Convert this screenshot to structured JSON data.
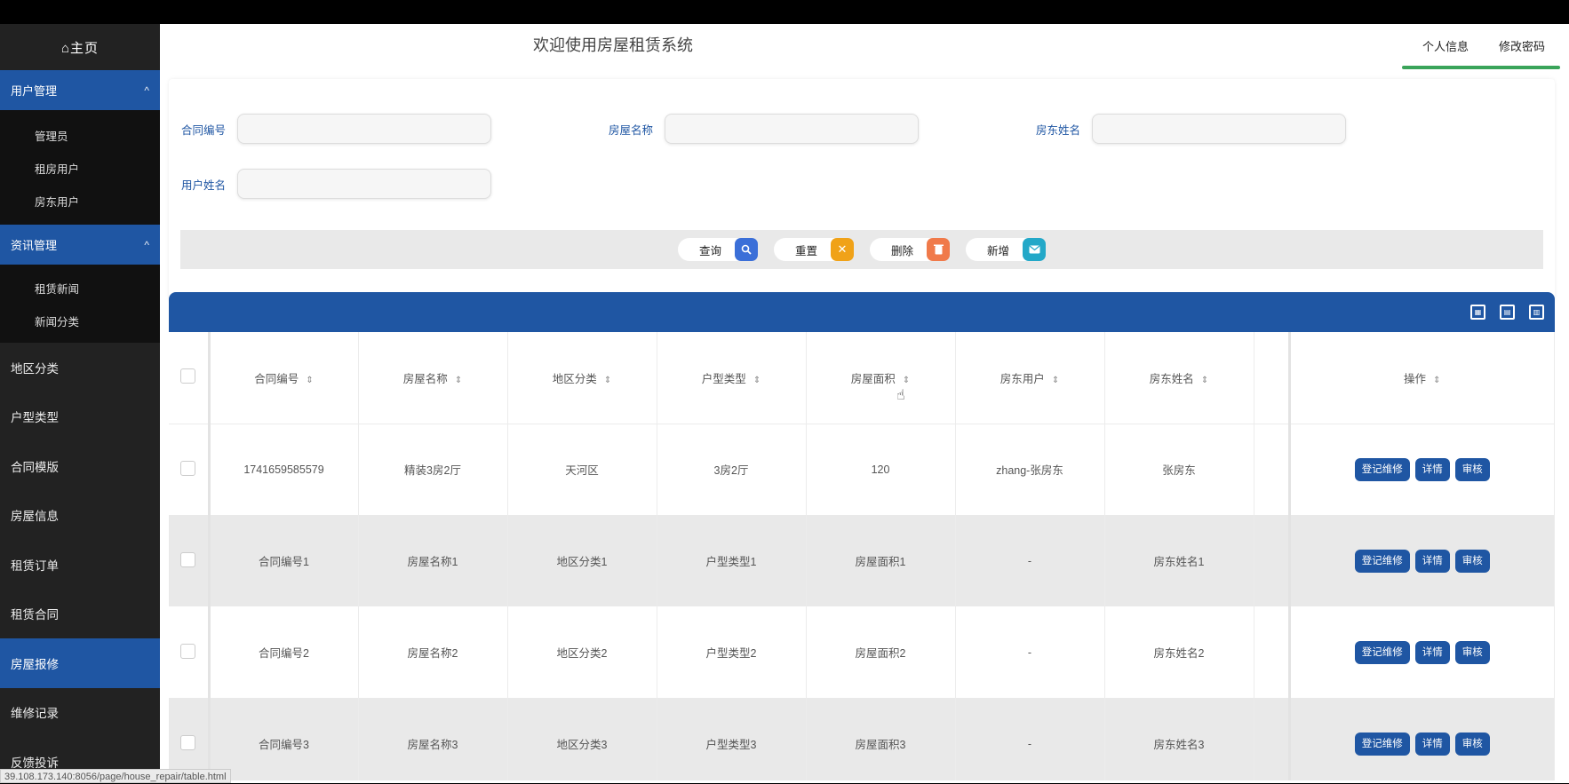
{
  "sidebar": {
    "home_label": "⌂主页",
    "groups": [
      {
        "label": "用户管理",
        "chevron": "^",
        "items": [
          "管理员",
          "租房用户",
          "房东用户"
        ]
      },
      {
        "label": "资讯管理",
        "chevron": "^",
        "items": [
          "租赁新闻",
          "新闻分类"
        ]
      }
    ],
    "items": [
      "地区分类",
      "户型类型",
      "合同模版",
      "房屋信息",
      "租赁订单",
      "租赁合同",
      "房屋报修",
      "维修记录",
      "反馈投诉"
    ],
    "active_item": "房屋报修"
  },
  "header": {
    "title": "欢迎使用房屋租赁系统",
    "tabs": [
      "个人信息",
      "修改密码"
    ]
  },
  "search": {
    "fields": [
      {
        "label": "合同编号",
        "value": ""
      },
      {
        "label": "房屋名称",
        "value": ""
      },
      {
        "label": "房东姓名",
        "value": ""
      },
      {
        "label": "用户姓名",
        "value": ""
      }
    ],
    "buttons": [
      {
        "label": "查询",
        "icon": "search-icon",
        "color": "#3b6fd8"
      },
      {
        "label": "重置",
        "icon": "close-icon",
        "color": "#f0a218"
      },
      {
        "label": "删除",
        "icon": "trash-icon",
        "color": "#f07a4a"
      },
      {
        "label": "新增",
        "icon": "mail-icon",
        "color": "#23a8c8"
      }
    ]
  },
  "table": {
    "columns": [
      "合同编号",
      "房屋名称",
      "地区分类",
      "户型类型",
      "房屋面积",
      "房东用户",
      "房东姓名",
      "操作"
    ],
    "sort_glyph": "⇕",
    "rows": [
      [
        "1741659585579",
        "精装3房2厅",
        "天河区",
        "3房2厅",
        "120",
        "zhang-张房东",
        "张房东"
      ],
      [
        "合同编号1",
        "房屋名称1",
        "地区分类1",
        "户型类型1",
        "房屋面积1",
        "-",
        "房东姓名1"
      ],
      [
        "合同编号2",
        "房屋名称2",
        "地区分类2",
        "户型类型2",
        "房屋面积2",
        "-",
        "房东姓名2"
      ],
      [
        "合同编号3",
        "房屋名称3",
        "地区分类3",
        "户型类型3",
        "房屋面积3",
        "-",
        "房东姓名3"
      ]
    ],
    "row_actions": [
      "登记维修",
      "详情",
      "审核"
    ]
  },
  "status_bar": {
    "url": "39.108.173.140:8056/page/house_repair/table.html"
  },
  "colors": {
    "primary": "#1f56a3",
    "sidebar_bg": "#222222",
    "active_tab_underline": "#3aa45a"
  }
}
